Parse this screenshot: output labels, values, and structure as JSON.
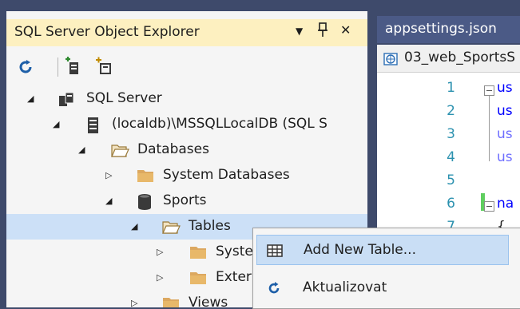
{
  "explorer": {
    "title": "SQL Server Object Explorer",
    "dropdown_glyph": "▼",
    "pin_glyph": "₽",
    "close_glyph": "✕"
  },
  "tree": [
    {
      "label": "SQL Server",
      "icon": "server-icon",
      "expanded": true
    },
    {
      "label": "(localdb)\\MSSQLLocalDB (SQL S",
      "icon": "db-instance-icon",
      "expanded": true
    },
    {
      "label": "Databases",
      "icon": "folder-open-icon",
      "expanded": true
    },
    {
      "label": "System Databases",
      "icon": "folder-icon",
      "expanded": false
    },
    {
      "label": "Sports",
      "icon": "database-icon",
      "expanded": true
    },
    {
      "label": "Tables",
      "icon": "folder-open-icon",
      "expanded": true,
      "selected": true
    },
    {
      "label": "Syste",
      "icon": "folder-icon",
      "expanded": false
    },
    {
      "label": "Exter",
      "icon": "folder-icon",
      "expanded": false
    },
    {
      "label": "Views",
      "icon": "folder-icon",
      "expanded": false
    }
  ],
  "editor": {
    "tab_label": "appsettings.json",
    "file_label": "03_web_SportsS",
    "line_numbers": [
      "1",
      "2",
      "3",
      "4",
      "5",
      "6",
      "7"
    ],
    "code": [
      "us",
      "us",
      "us",
      "us",
      "",
      "na",
      "{"
    ]
  },
  "context_menu": {
    "items": [
      {
        "label": "Add New Table...",
        "icon": "table-grid-icon"
      },
      {
        "label": "Aktualizovat",
        "icon": "refresh-icon"
      }
    ]
  },
  "colors": {
    "header_bg": "#fdf0c0",
    "selection_bg": "#cce0f7",
    "tab_bg": "#4b5a86",
    "keyword_blue": "#0000ff",
    "line_number": "#2b91af"
  }
}
